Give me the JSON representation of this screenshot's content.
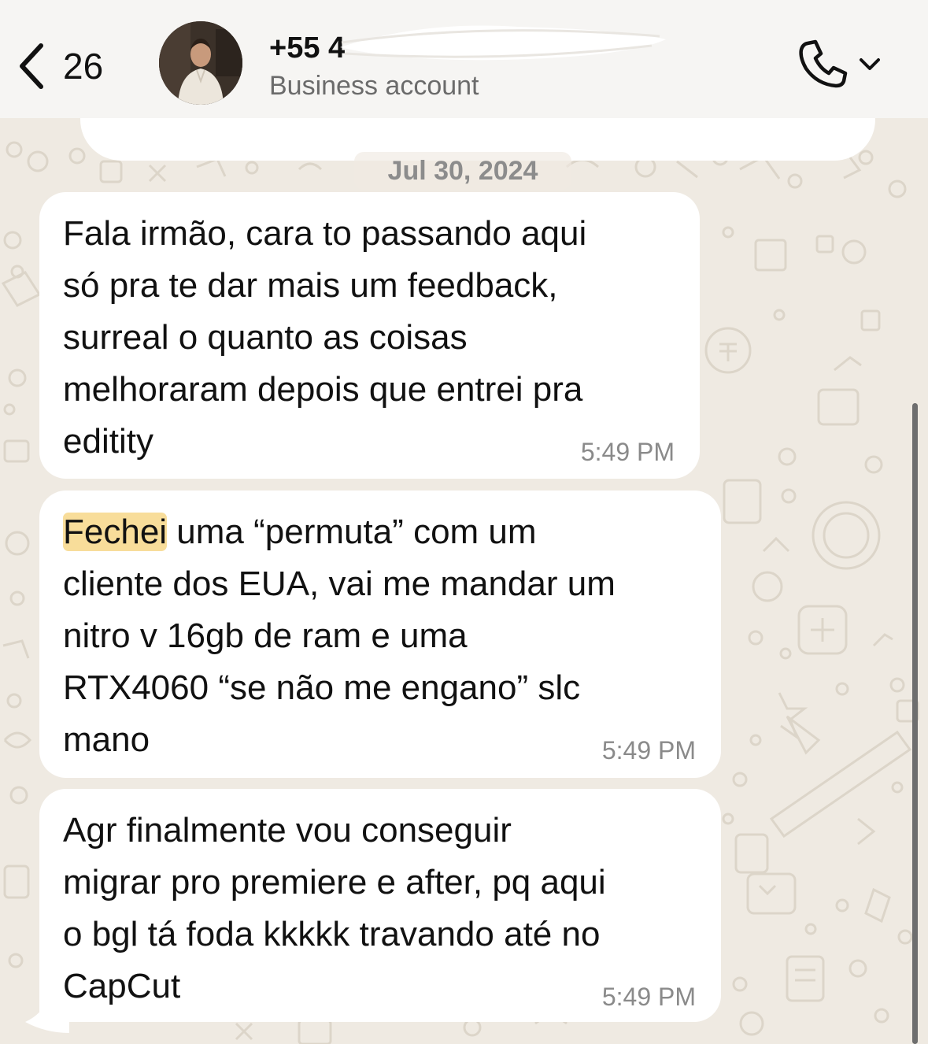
{
  "header": {
    "back_count": "26",
    "contact_name": "+55 4",
    "contact_subtitle": "Business account",
    "call_icon": "phone-icon",
    "call_menu_icon": "chevron-down-icon",
    "back_icon": "chevron-left-icon"
  },
  "chat": {
    "date_separator": "Jul 30, 2024",
    "messages": [
      {
        "text": "Fala irmão, cara to passando aqui\nsó pra te dar mais um feedback,\nsurreal o quanto as coisas\nmelhoraram depois que entrei pra\neditity",
        "time": "5:49 PM"
      },
      {
        "highlight": "Fechei",
        "text": " uma “permuta” com um\ncliente dos EUA, vai me mandar um\nnitro v 16gb de ram e uma\nRTX4060 “se não me engano” slc\nmano",
        "time": "5:49 PM"
      },
      {
        "text": "Agr finalmente vou conseguir\nmigrar pro premiere e after, pq aqui\no bgl tá foda kkkkk travando até no\nCapCut",
        "time": "5:49 PM"
      }
    ]
  },
  "colors": {
    "wallpaper": "#efeae2",
    "bubble": "#ffffff",
    "highlight": "#f8dd9a",
    "timestamp": "#8a8a8a"
  }
}
